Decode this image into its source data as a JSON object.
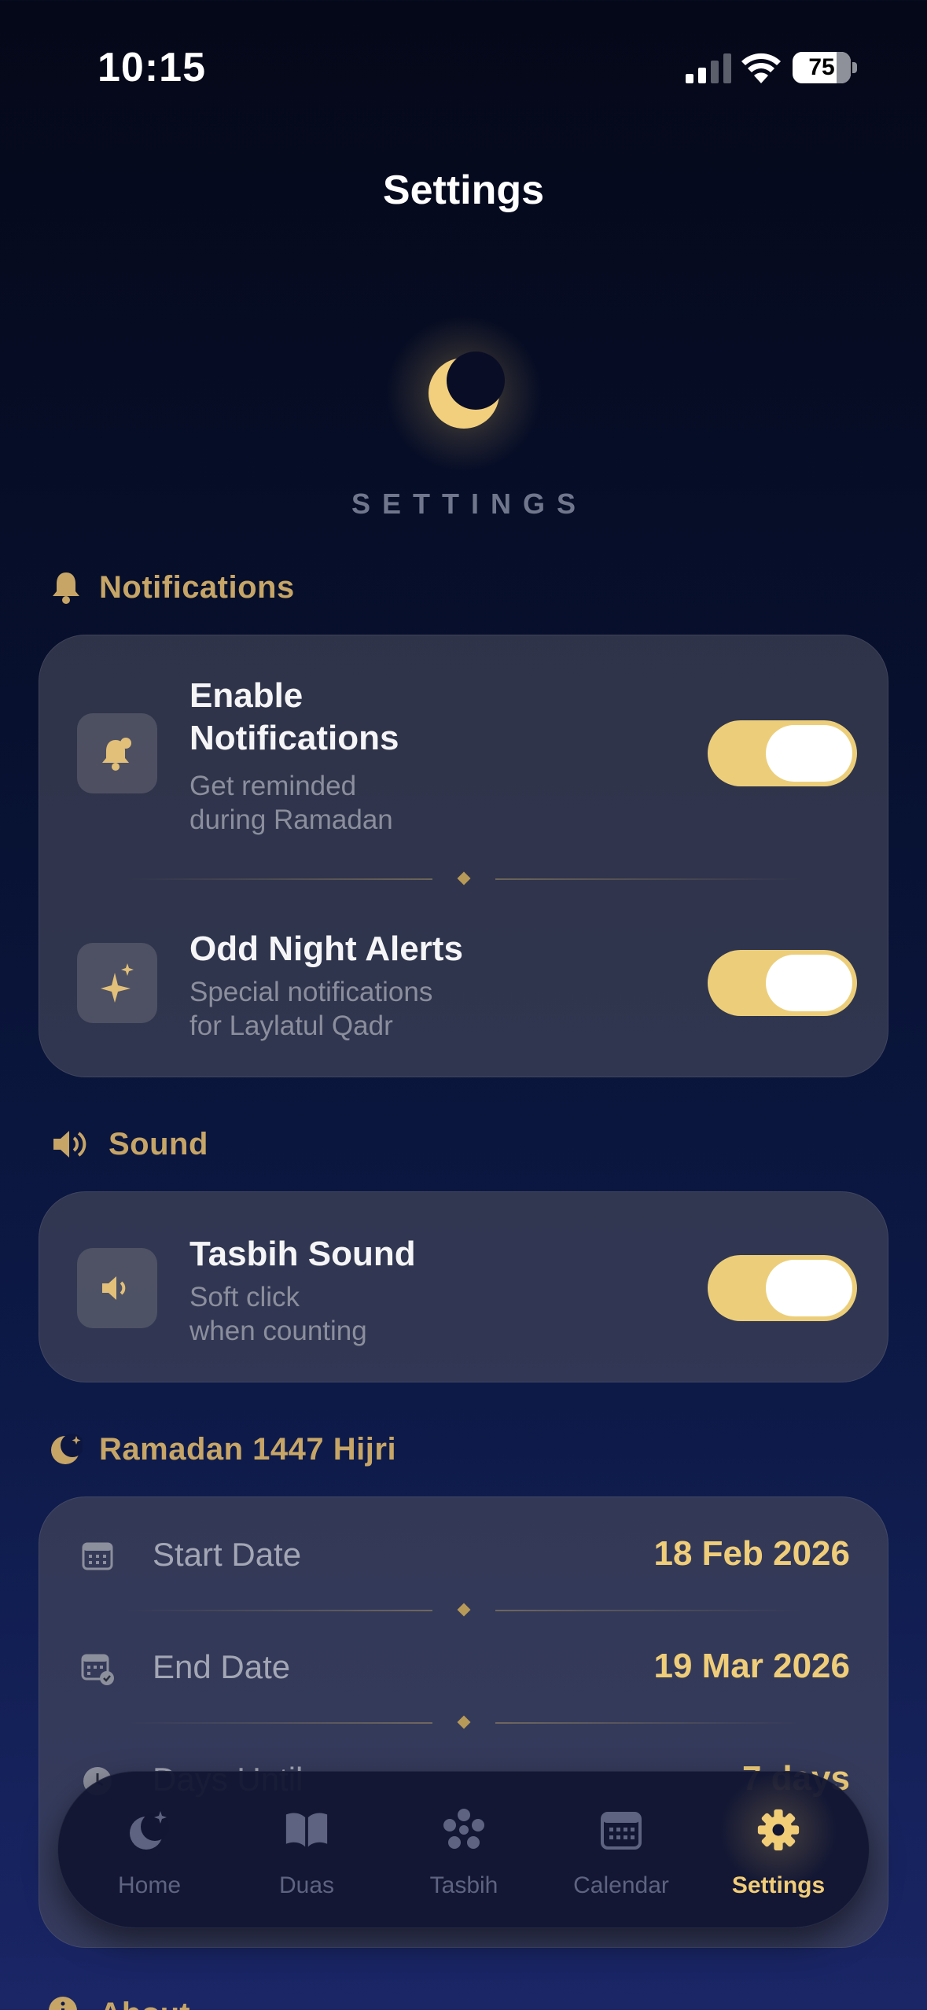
{
  "status_bar": {
    "time": "10:15",
    "battery": "75"
  },
  "nav": {
    "title": "Settings"
  },
  "hero": {
    "label": "SETTINGS",
    "icon": "crescent-moon-icon"
  },
  "colors": {
    "accent": "#efcd79",
    "section": "#c6a567",
    "toggle_on": "#ecce7a"
  },
  "notifications": {
    "header": "Notifications",
    "items": [
      {
        "title_line1": "Enable",
        "title_line2": "Notifications",
        "sub_line1": "Get reminded",
        "sub_line2": "during Ramadan",
        "enabled": true,
        "icon": "bell-icon"
      },
      {
        "title": "Odd Night Alerts",
        "sub_line1": "Special notifications",
        "sub_line2": "for Laylatul Qadr",
        "enabled": true,
        "icon": "sparkle-icon"
      }
    ]
  },
  "sound": {
    "header": "Sound",
    "items": [
      {
        "title": "Tasbih Sound",
        "sub_line1": "Soft click",
        "sub_line2": "when counting",
        "enabled": true,
        "icon": "speaker-icon"
      }
    ]
  },
  "ramadan": {
    "header": "Ramadan 1447 Hijri",
    "rows": [
      {
        "label": "Start Date",
        "value": "18 Feb 2026",
        "icon": "calendar-icon"
      },
      {
        "label": "End Date",
        "value": "19 Mar 2026",
        "icon": "calendar-check-icon"
      },
      {
        "label": "Days Until",
        "value": "7 days",
        "icon": "clock-icon"
      }
    ]
  },
  "about": {
    "header": "About"
  },
  "tabbar": {
    "active": "Settings",
    "tabs": [
      {
        "label": "Home",
        "icon": "moon-star-icon"
      },
      {
        "label": "Duas",
        "icon": "book-icon"
      },
      {
        "label": "Tasbih",
        "icon": "beads-icon"
      },
      {
        "label": "Calendar",
        "icon": "calendar-icon"
      },
      {
        "label": "Settings",
        "icon": "gear-icon"
      }
    ]
  }
}
